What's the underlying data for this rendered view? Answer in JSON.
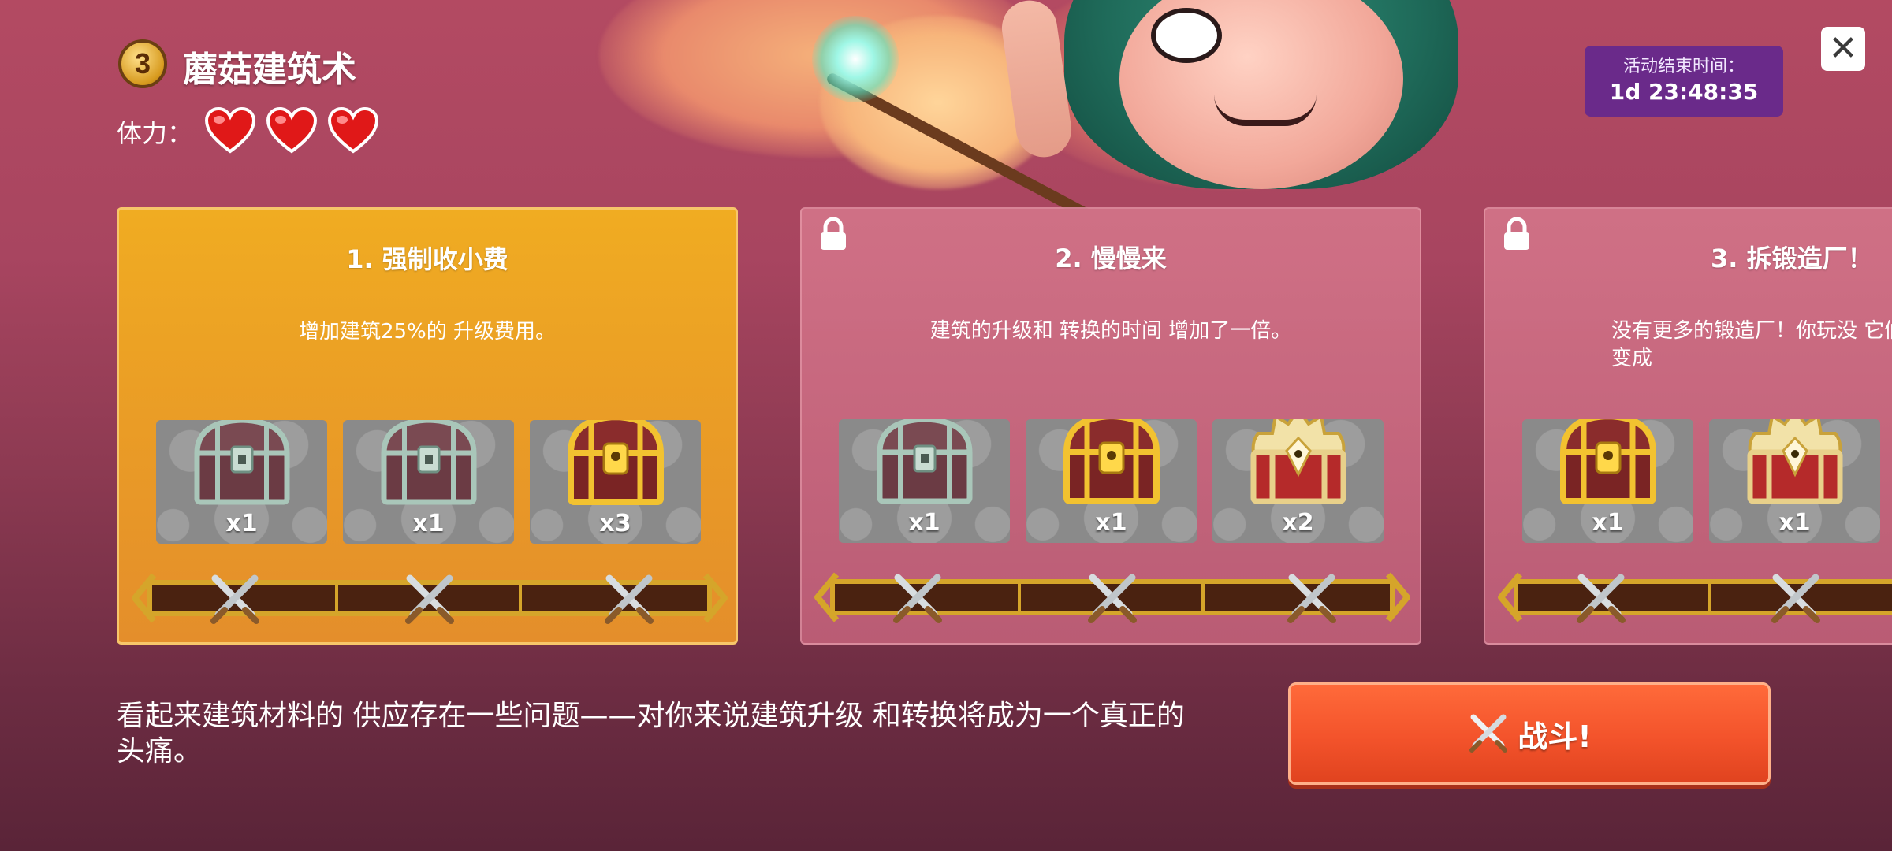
{
  "header": {
    "level": "3",
    "title": "蘑菇建筑术",
    "stamina_label": "体力：",
    "hearts": 3
  },
  "timer": {
    "label": "活动结束时间：",
    "value": "1d 23:48:35"
  },
  "close_icon": "close-icon",
  "stages": [
    {
      "title": "1. 强制收小费",
      "desc": "增加建筑25%的 升级费用。",
      "locked": false,
      "rewards": [
        {
          "chest": "silver-chest",
          "qty": "x1"
        },
        {
          "chest": "silver-chest",
          "qty": "x1"
        },
        {
          "chest": "gold-chest",
          "qty": "x3"
        }
      ]
    },
    {
      "title": "2. 慢慢来",
      "desc": "建筑的升级和 转换的时间 增加了一倍。",
      "locked": true,
      "rewards": [
        {
          "chest": "silver-chest",
          "qty": "x1"
        },
        {
          "chest": "gold-chest",
          "qty": "x1"
        },
        {
          "chest": "royal-chest",
          "qty": "x2"
        }
      ]
    },
    {
      "title": "3. 拆锻造厂！",
      "desc": "没有更多的锻造厂！你玩没 它们。当被占据时，它们变成",
      "locked": true,
      "rewards": [
        {
          "chest": "gold-chest",
          "qty": "x1"
        },
        {
          "chest": "royal-chest",
          "qty": "x1"
        }
      ]
    }
  ],
  "story": "看起来建筑材料的 供应存在一些问题——对你来说建筑升级 和转换将成为一个真正的头痛。",
  "fight_button": {
    "label": "战斗!",
    "icon": "crossed-swords-icon"
  },
  "colors": {
    "active_card": "#f0ac22",
    "locked_card": "#d6788c",
    "timer_bg": "#6a2a8a",
    "fight_btn": "#f3532b"
  }
}
